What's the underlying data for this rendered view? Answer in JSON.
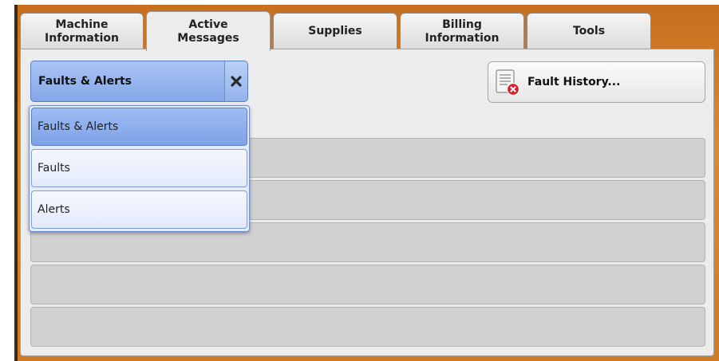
{
  "tabs": [
    {
      "label": "Machine\nInformation",
      "active": false
    },
    {
      "label": "Active\nMessages",
      "active": true
    },
    {
      "label": "Supplies",
      "active": false
    },
    {
      "label": "Billing\nInformation",
      "active": false
    },
    {
      "label": "Tools",
      "active": false
    }
  ],
  "filter": {
    "selected": "Faults & Alerts",
    "close_icon": "close-icon",
    "options": [
      "Faults & Alerts",
      "Faults",
      "Alerts"
    ],
    "selected_index": 0
  },
  "fault_history": {
    "label": "Fault History...",
    "icon": "fault-history-icon"
  },
  "message_rows": [
    "",
    "",
    "",
    "",
    ""
  ],
  "colors": {
    "frame": "#d98a35",
    "selected_blue": "#85a7e8",
    "option_blue": "#e2eafb",
    "row_gray": "#d2d0d1",
    "panel_gray": "#ececec",
    "error_red": "#d9232e"
  }
}
